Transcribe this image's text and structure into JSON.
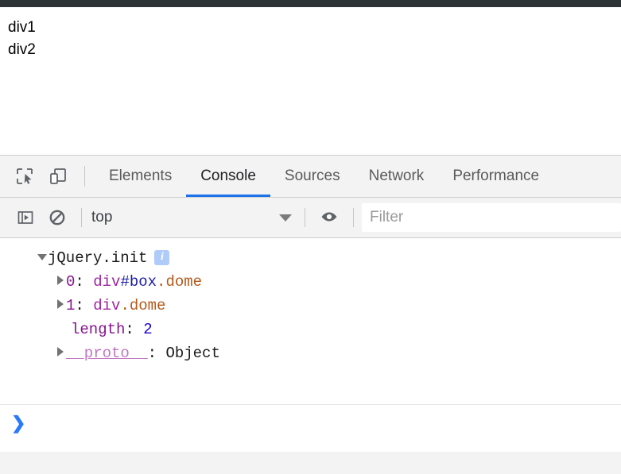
{
  "browser": {
    "chrome_bar_color": "#2e3336"
  },
  "page": {
    "lines": [
      "div1",
      "div2"
    ]
  },
  "devtools": {
    "toolbar": {
      "inspect_icon": "inspect-element-icon",
      "device_icon": "device-toolbar-icon"
    },
    "tabs": [
      {
        "label": "Elements",
        "active": false
      },
      {
        "label": "Console",
        "active": true
      },
      {
        "label": "Sources",
        "active": false
      },
      {
        "label": "Network",
        "active": false
      },
      {
        "label": "Performance",
        "active": false
      }
    ],
    "active_tab_accent": "#1a73e8",
    "console_toolbar": {
      "sidebar_toggle_icon": "console-sidebar-toggle-icon",
      "clear_icon": "clear-console-icon",
      "context_value": "top",
      "context_arrow_icon": "chevron-down-icon",
      "eye_icon": "live-expression-eye-icon",
      "filter_placeholder": "Filter",
      "filter_value": ""
    },
    "console_output": {
      "rows": [
        {
          "indent": 1,
          "twisty": "open",
          "tokens": [
            {
              "text": "jQuery.init",
              "kind": "obj"
            }
          ],
          "badge": "i"
        },
        {
          "indent": 2,
          "twisty": "closed",
          "tokens": [
            {
              "text": "0",
              "kind": "key"
            },
            {
              "text": ": ",
              "kind": "colon"
            },
            {
              "text": "div",
              "kind": "tag"
            },
            {
              "text": "#box",
              "kind": "id"
            },
            {
              "text": ".dome",
              "kind": "cls"
            }
          ]
        },
        {
          "indent": 2,
          "twisty": "closed",
          "tokens": [
            {
              "text": "1",
              "kind": "key"
            },
            {
              "text": ": ",
              "kind": "colon"
            },
            {
              "text": "div",
              "kind": "tag"
            },
            {
              "text": ".dome",
              "kind": "cls"
            }
          ]
        },
        {
          "indent": 2,
          "twisty": "none",
          "tokens": [
            {
              "text": "length",
              "kind": "key"
            },
            {
              "text": ": ",
              "kind": "colon"
            },
            {
              "text": "2",
              "kind": "num"
            }
          ]
        },
        {
          "indent": 2,
          "twisty": "closed",
          "tokens": [
            {
              "text": "__proto__",
              "kind": "proto"
            },
            {
              "text": ": ",
              "kind": "colon"
            },
            {
              "text": "Object",
              "kind": "plain"
            }
          ]
        }
      ]
    },
    "prompt": {
      "chevron": "❯",
      "value": ""
    }
  }
}
